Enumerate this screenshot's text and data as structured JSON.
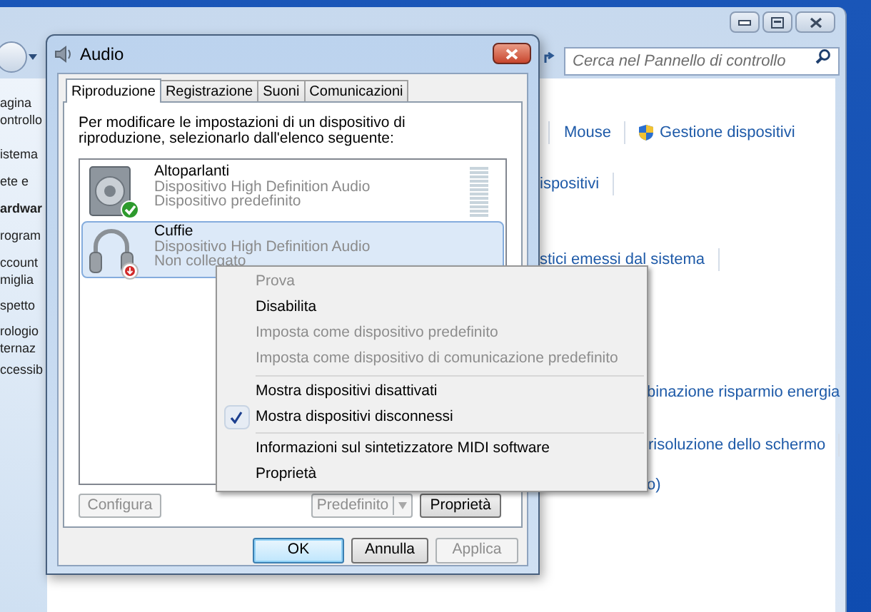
{
  "control_panel": {
    "search": {
      "placeholder": "Cerca nel Pannello di controllo"
    },
    "left_pane": [
      {
        "text": "agina",
        "bold": false
      },
      {
        "text": "ontrollo",
        "bold": false
      },
      {
        "text": "istema",
        "bold": false
      },
      {
        "text": "ete e",
        "bold": false
      },
      {
        "text": "ardwar",
        "bold": true
      },
      {
        "text": "rogram",
        "bold": false
      },
      {
        "text": "ccount",
        "bold": false
      },
      {
        "text": "miglia",
        "bold": false
      },
      {
        "text": "spetto",
        "bold": false
      },
      {
        "text": "rologio",
        "bold": false
      },
      {
        "text": "ternaz",
        "bold": false
      },
      {
        "text": "ccessib",
        "bold": false
      }
    ],
    "link_rows": [
      {
        "separator_before": true,
        "links": [
          {
            "text": "Mouse",
            "shield": false,
            "separator_after": true
          },
          {
            "text": "Gestione dispositivi",
            "shield": true,
            "separator_after": false
          }
        ]
      },
      {
        "separator_before": false,
        "links": [
          {
            "text": "ispositivi",
            "shield": false,
            "separator_after": true
          }
        ]
      },
      {
        "separator_before": false,
        "links": [
          {
            "text": "stici emessi dal sistema",
            "shield": false,
            "separator_after": true
          }
        ]
      },
      {
        "separator_before": false,
        "links": [
          {
            "text": "binazione risparmio energia",
            "shield": false,
            "separator_after": false
          }
        ]
      },
      {
        "separator_before": false,
        "links": [
          {
            "text": "risoluzione dello schermo",
            "shield": false,
            "separator_after": true
          }
        ]
      },
      {
        "separator_before": false,
        "links": [
          {
            "text": "o)",
            "shield": false,
            "separator_after": false
          }
        ]
      }
    ]
  },
  "dialog": {
    "title": "Audio",
    "tabs": [
      {
        "label": "Riproduzione",
        "selected": true
      },
      {
        "label": "Registrazione",
        "selected": false
      },
      {
        "label": "Suoni",
        "selected": false
      },
      {
        "label": "Comunicazioni",
        "selected": false
      }
    ],
    "instruction": "Per modificare le impostazioni di un dispositivo di riproduzione, selezionarlo dall'elenco seguente:",
    "devices": [
      {
        "kind": "speaker",
        "name": "Altoparlanti",
        "lines": [
          "Dispositivo High Definition Audio",
          "Dispositivo predefinito"
        ],
        "is_default": true,
        "connected": true,
        "selected": false,
        "level": 0
      },
      {
        "kind": "headphones",
        "name": "Cuffie",
        "lines": [
          "Dispositivo High Definition Audio",
          "Non collegato"
        ],
        "is_default": false,
        "connected": false,
        "selected": true
      }
    ],
    "list_buttons": [
      {
        "kind": "plain",
        "label": "Configura",
        "disabled": true
      },
      {
        "kind": "split",
        "label": "Predefinito",
        "disabled": true
      },
      {
        "kind": "plain",
        "label": "Proprietà",
        "disabled": false
      }
    ],
    "buttons": [
      {
        "label": "OK",
        "disabled": false,
        "default": true
      },
      {
        "label": "Annulla",
        "disabled": false,
        "default": false
      },
      {
        "label": "Applica",
        "disabled": true,
        "default": false
      }
    ]
  },
  "context_menu": {
    "items": [
      {
        "kind": "item",
        "label": "Prova",
        "disabled": true,
        "checked": false
      },
      {
        "kind": "item",
        "label": "Disabilita",
        "disabled": false,
        "checked": false
      },
      {
        "kind": "item",
        "label": "Imposta come dispositivo predefinito",
        "disabled": true,
        "checked": false
      },
      {
        "kind": "item",
        "label": "Imposta come dispositivo di comunicazione predefinito",
        "disabled": true,
        "checked": false
      },
      {
        "kind": "separator"
      },
      {
        "kind": "item",
        "label": "Mostra dispositivi disattivati",
        "disabled": false,
        "checked": false
      },
      {
        "kind": "item",
        "label": "Mostra dispositivi disconnessi",
        "disabled": false,
        "checked": true
      },
      {
        "kind": "separator"
      },
      {
        "kind": "item",
        "label": "Informazioni sul sintetizzatore MIDI software",
        "disabled": false,
        "checked": false
      },
      {
        "kind": "item",
        "label": "Proprietà",
        "disabled": false,
        "checked": false
      }
    ]
  }
}
